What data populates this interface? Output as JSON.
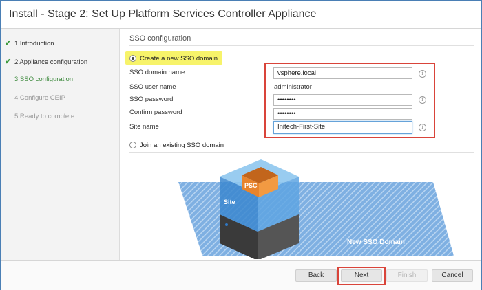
{
  "window": {
    "title": "Install - Stage 2: Set Up Platform Services Controller Appliance"
  },
  "sidebar": {
    "steps": [
      {
        "label": "1 Introduction",
        "state": "done"
      },
      {
        "label": "2 Appliance configuration",
        "state": "done"
      },
      {
        "label": "3 SSO configuration",
        "state": "active"
      },
      {
        "label": "4 Configure CEIP",
        "state": "pending"
      },
      {
        "label": "5 Ready to complete",
        "state": "pending"
      }
    ]
  },
  "main": {
    "section_title": "SSO configuration",
    "option_new": "Create a new SSO domain",
    "option_join": "Join an existing SSO domain",
    "fields": {
      "domain_name": {
        "label": "SSO domain name",
        "value": "vsphere.local"
      },
      "user_name": {
        "label": "SSO user name",
        "value": "administrator"
      },
      "password": {
        "label": "SSO password",
        "value": "••••••••"
      },
      "confirm": {
        "label": "Confirm password",
        "value": "••••••••"
      },
      "site_name": {
        "label": "Site name",
        "value": "Initech-First-Site"
      }
    },
    "info_icon_glyph": "i",
    "graphic": {
      "caption": "New SSO Domain",
      "site_label": "Site",
      "psc_label": "PSC"
    }
  },
  "footer": {
    "back": "Back",
    "next": "Next",
    "finish": "Finish",
    "cancel": "Cancel"
  },
  "colors": {
    "highlight": "#f7f36a",
    "annotation_red": "#d9443a",
    "check_green": "#3d9a3d",
    "graphic_blue": "#2f78c4",
    "psc_orange": "#e8842c"
  }
}
